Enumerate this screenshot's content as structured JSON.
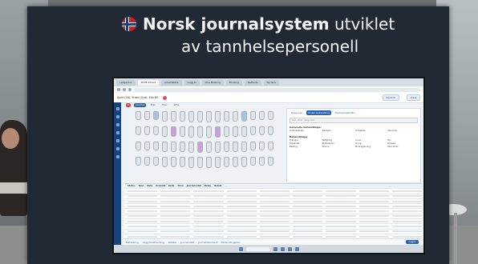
{
  "headline": {
    "brand": "Norsk journalsystem",
    "rest_line1": "utviklet",
    "line2": "av tannhelsepersonell"
  },
  "screen": {
    "browser_tabs": [
      "Ledgerdoc",
      "Profil Arbeid",
      "Arbeidsliste",
      "Legg til",
      "Oria Booking",
      "Booking",
      "Nettside",
      "Ny fane"
    ],
    "app_header": {
      "patient_label": "Aldri (34), Fram (Gut): Ola 65",
      "header_button_1": "Kontroll",
      "header_button_2": "Klart"
    },
    "journal_tabs": [
      "Journal",
      "Plan",
      "Filer",
      "SFM"
    ],
    "right_pane": {
      "tabs": [
        "Diagnose",
        "Under behandling",
        "Fremgangsmåte"
      ],
      "search_placeholder": "Søk etter diagnose",
      "section_1": "Generelle behandlinger",
      "section_2": "Behandlinger",
      "items": [
        "Undersøkelse",
        "Røntgen",
        "Profylakse",
        "Tannrens",
        "Fyllinger",
        "Rotfylling",
        "Krone",
        "Bro",
        "Implantat",
        "Ekstraksjon",
        "Kirurgi",
        "Protese",
        "Bleking",
        "Skinne",
        "Tannregulering",
        "Periodonti"
      ]
    },
    "table": {
      "columns": [
        "Status",
        "Tann",
        "Dato",
        "Produkt",
        "Kode",
        "Trinn",
        "Journalnotat",
        "Beløp",
        "Betalt"
      ],
      "row_count": 12
    },
    "bottom_bar": {
      "items": [
        "Fakturering",
        "Legg til behandling",
        "Notater",
        "Journalnotat",
        "Journaldokument",
        "Behandlingsplan"
      ],
      "save_label": "Lagre"
    }
  }
}
